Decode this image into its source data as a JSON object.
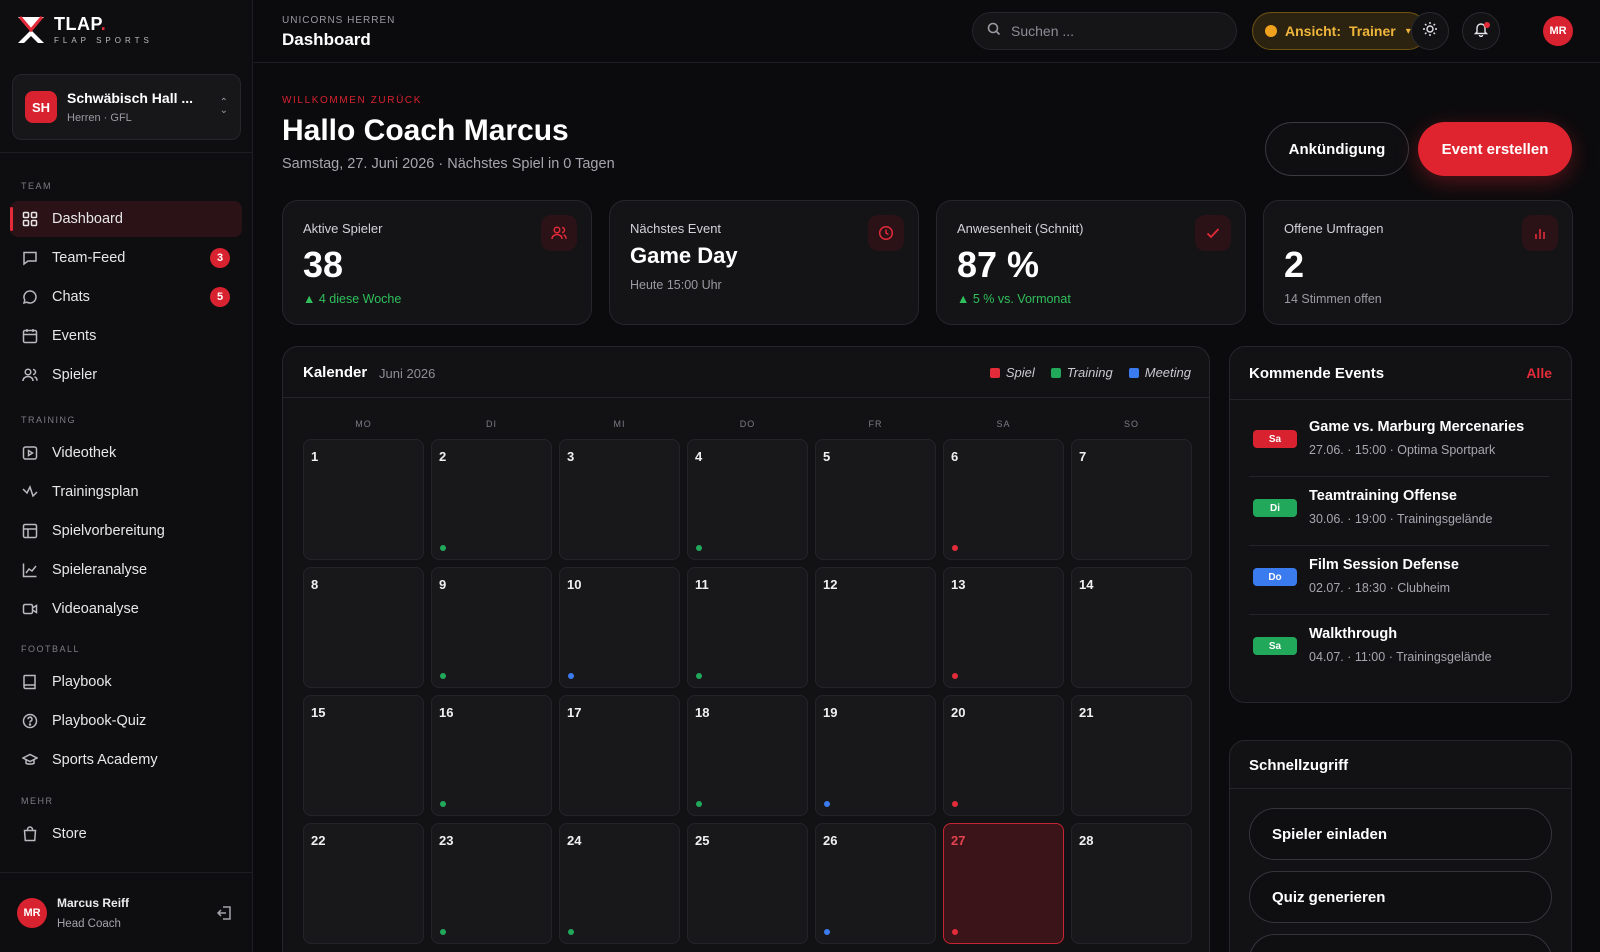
{
  "brand": {
    "name": "TLAP",
    "name_dot": ".",
    "sub": "FLAP SPORTS"
  },
  "team": {
    "avatar": "SH",
    "name": "Schwäbisch Hall ...",
    "sub": "Herren · GFL"
  },
  "sidebar": {
    "sections": {
      "team": "TEAM",
      "training": "TRAINING",
      "football": "FOOTBALL",
      "mehr": "MEHR"
    },
    "items": [
      {
        "label": "Dashboard",
        "icon": "grid-icon"
      },
      {
        "label": "Team-Feed",
        "icon": "message-square-icon",
        "badge": "3"
      },
      {
        "label": "Chats",
        "icon": "chat-bubble-icon",
        "badge": "5"
      },
      {
        "label": "Events",
        "icon": "calendar-icon"
      },
      {
        "label": "Spieler",
        "icon": "users-icon"
      },
      {
        "label": "Videothek",
        "icon": "play-box-icon"
      },
      {
        "label": "Trainingsplan",
        "icon": "activity-icon"
      },
      {
        "label": "Spielvorbereitung",
        "icon": "layout-icon"
      },
      {
        "label": "Spieleranalyse",
        "icon": "line-chart-icon"
      },
      {
        "label": "Videoanalyse",
        "icon": "video-icon"
      },
      {
        "label": "Playbook",
        "icon": "book-icon"
      },
      {
        "label": "Playbook-Quiz",
        "icon": "help-circle-icon"
      },
      {
        "label": "Sports Academy",
        "icon": "graduation-cap-icon"
      },
      {
        "label": "Store",
        "icon": "shopping-bag-icon"
      }
    ],
    "user": {
      "initials": "MR",
      "name": "Marcus Reiff",
      "role": "Head Coach"
    }
  },
  "topbar": {
    "crumb_small": "UNICORNS HERREN",
    "crumb_title": "Dashboard",
    "search_placeholder": "Suchen ...",
    "view_label": "Ansicht:",
    "view_value": "Trainer",
    "avatar": "MR"
  },
  "main": {
    "welcome": "WILLKOMMEN ZURÜCK",
    "greeting": "Hallo Coach Marcus",
    "date_line": "Samstag, 27. Juni 2026 · Nächstes Spiel in 0 Tagen",
    "btn_announce": "Ankündigung",
    "btn_create": "Event erstellen"
  },
  "stats": [
    {
      "label": "Aktive Spieler",
      "value": "38",
      "sub": "▲ 4 diese Woche",
      "icon": "users-icon"
    },
    {
      "label": "Nächstes Event",
      "value": "Game Day",
      "sub": "Heute 15:00 Uhr",
      "icon": "clock-icon"
    },
    {
      "label": "Anwesenheit (Schnitt)",
      "value": "87 %",
      "sub": "▲ 5 % vs. Vormonat",
      "icon": "check-icon"
    },
    {
      "label": "Offene Umfragen",
      "value": "2",
      "sub": "14 Stimmen offen",
      "icon": "bar-chart-icon"
    }
  ],
  "calendar": {
    "title": "Kalender",
    "month": "Juni 2026",
    "legend": [
      {
        "label": "Spiel",
        "color": "#e32b3a"
      },
      {
        "label": "Training",
        "color": "#22a85a"
      },
      {
        "label": "Meeting",
        "color": "#3b7bf0"
      }
    ],
    "weekdays": [
      "MO",
      "DI",
      "MI",
      "DO",
      "FR",
      "SA",
      "SO"
    ],
    "days": [
      {
        "n": "1",
        "dot": ""
      },
      {
        "n": "2",
        "dot": "training"
      },
      {
        "n": "3",
        "dot": ""
      },
      {
        "n": "4",
        "dot": "training"
      },
      {
        "n": "5",
        "dot": ""
      },
      {
        "n": "6",
        "dot": "spiel"
      },
      {
        "n": "7",
        "dot": ""
      },
      {
        "n": "8",
        "dot": ""
      },
      {
        "n": "9",
        "dot": "training"
      },
      {
        "n": "10",
        "dot": "meeting"
      },
      {
        "n": "11",
        "dot": "training"
      },
      {
        "n": "12",
        "dot": ""
      },
      {
        "n": "13",
        "dot": "spiel"
      },
      {
        "n": "14",
        "dot": ""
      },
      {
        "n": "15",
        "dot": ""
      },
      {
        "n": "16",
        "dot": "training"
      },
      {
        "n": "17",
        "dot": ""
      },
      {
        "n": "18",
        "dot": "training"
      },
      {
        "n": "19",
        "dot": "meeting"
      },
      {
        "n": "20",
        "dot": "spiel"
      },
      {
        "n": "21",
        "dot": ""
      },
      {
        "n": "22",
        "dot": ""
      },
      {
        "n": "23",
        "dot": "training"
      },
      {
        "n": "24",
        "dot": "training"
      },
      {
        "n": "25",
        "dot": ""
      },
      {
        "n": "26",
        "dot": "meeting"
      },
      {
        "n": "27",
        "dot": "spiel",
        "today": true
      },
      {
        "n": "28",
        "dot": ""
      }
    ]
  },
  "events": {
    "title": "Kommende Events",
    "all": "Alle",
    "items": [
      {
        "badge": "Sa",
        "color": "#d8222f",
        "name": "Game vs. Marburg Mercenaries",
        "meta": "27.06. · 15:00 · Optima Sportpark"
      },
      {
        "badge": "Di",
        "color": "#22a85a",
        "name": "Teamtraining Offense",
        "meta": "30.06. · 19:00 · Trainingsgelände"
      },
      {
        "badge": "Do",
        "color": "#3b7bf0",
        "name": "Film Session Defense",
        "meta": "02.07. · 18:30 · Clubheim"
      },
      {
        "badge": "Sa",
        "color": "#22a85a",
        "name": "Walkthrough",
        "meta": "04.07. · 11:00 · Trainingsgelände"
      }
    ]
  },
  "quick": {
    "title": "Schnellzugriff",
    "buttons": [
      "Spieler einladen",
      "Quiz generieren",
      ""
    ]
  }
}
